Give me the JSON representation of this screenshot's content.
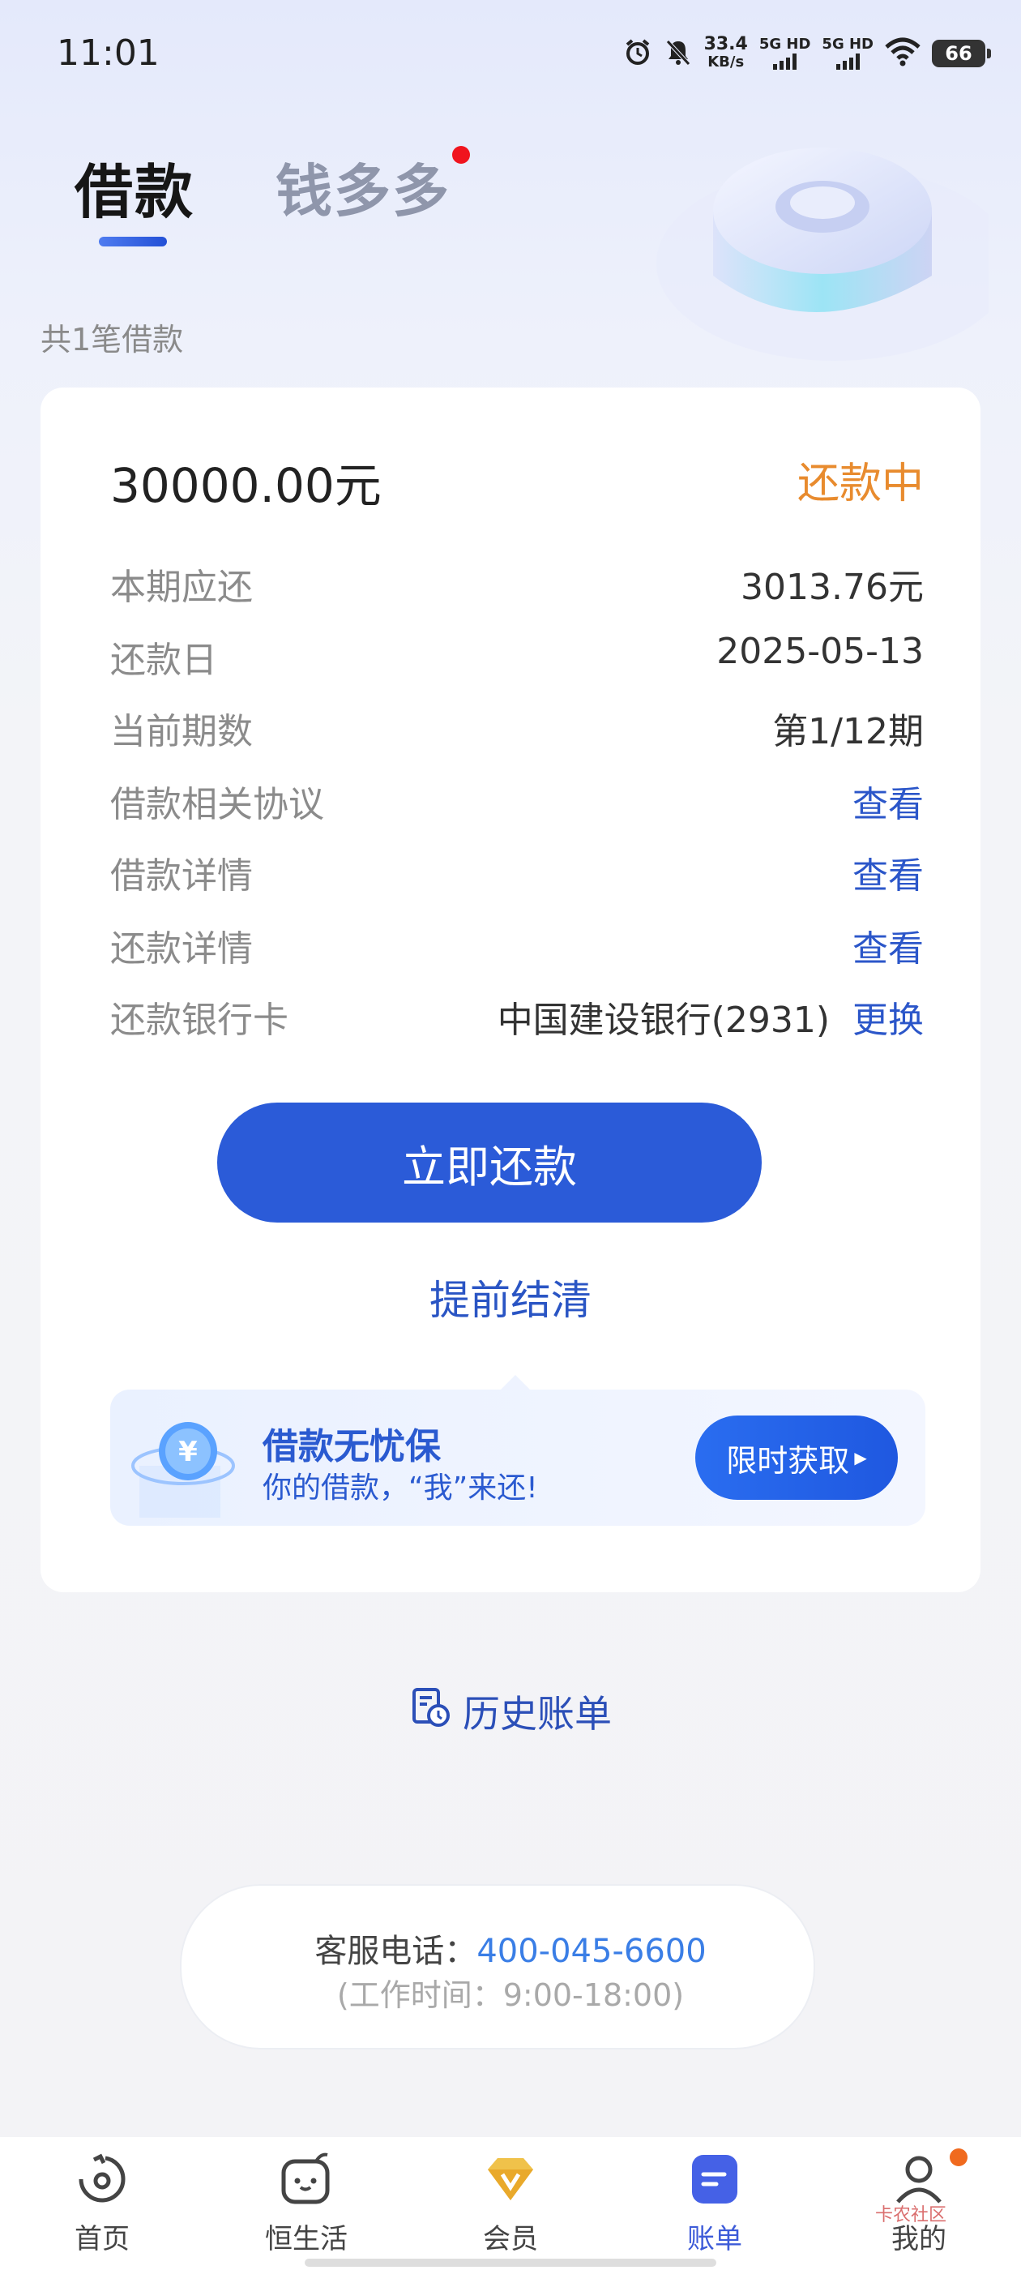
{
  "status_bar": {
    "time": "11:01",
    "net_speed_value": "33.4",
    "net_speed_unit": "KB/s",
    "sim1_label": "5G HD",
    "sim2_label": "5G HD",
    "battery": "66"
  },
  "tabs": [
    {
      "label": "借款",
      "active": true
    },
    {
      "label": "钱多多",
      "active": false,
      "has_dot": true
    }
  ],
  "loan_count": "共1笔借款",
  "loan": {
    "amount": "30000.00元",
    "status": "还款中",
    "rows": [
      {
        "label": "本期应还",
        "value": "3013.76元"
      },
      {
        "label": "还款日",
        "value": "2025-05-13"
      },
      {
        "label": "当前期数",
        "value": "第1/12期"
      },
      {
        "label": "借款相关协议",
        "value": "查看"
      },
      {
        "label": "借款详情",
        "value": "查看"
      },
      {
        "label": "还款详情",
        "value": "查看"
      }
    ],
    "bank_card_label": "还款银行卡",
    "bank_card_value": "中国建设银行(2931)",
    "bank_card_change": "更换",
    "pay_button": "立即还款",
    "early_settle": "提前结清"
  },
  "promo": {
    "title": "借款无忧保",
    "subtitle": "你的借款，“我”来还!",
    "button": "限时获取"
  },
  "history_label": "历史账单",
  "service": {
    "prefix": "客服电话：",
    "phone": "400-045-6600",
    "hours": "(工作时间：9:00-18:00)"
  },
  "bottom_nav": [
    {
      "label": "首页",
      "icon": "home-icon"
    },
    {
      "label": "恒生活",
      "icon": "life-icon"
    },
    {
      "label": "会员",
      "icon": "vip-icon"
    },
    {
      "label": "账单",
      "icon": "bill-icon",
      "active": true
    },
    {
      "label": "我的",
      "icon": "profile-icon",
      "badge": true
    }
  ],
  "watermark": "卡农社区",
  "colors": {
    "primary": "#2b5bd8",
    "status_orange": "#e88b2e",
    "link_blue": "#2b56c9"
  }
}
